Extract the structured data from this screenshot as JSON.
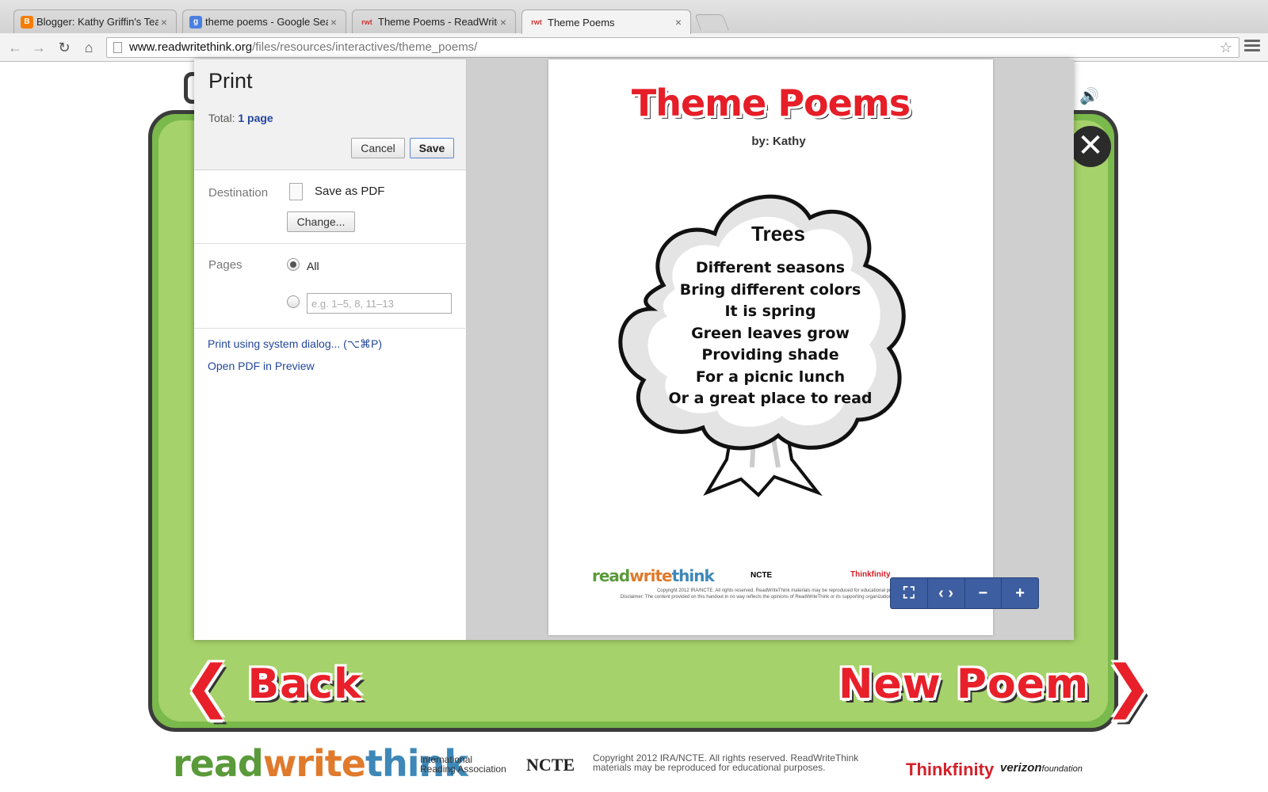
{
  "browser": {
    "tabs": [
      {
        "favicon": "B",
        "title": "Blogger: Kathy Griffin's Tea",
        "active": false
      },
      {
        "favicon": "g",
        "title": "theme poems - Google Sea",
        "active": false
      },
      {
        "favicon": "rwt",
        "title": "Theme Poems - ReadWrite",
        "active": false
      },
      {
        "favicon": "rwt",
        "title": "Theme Poems",
        "active": true
      }
    ],
    "url_host": "www.readwritethink.org",
    "url_path": "/files/resources/interactives/theme_poems/"
  },
  "print_dialog": {
    "title": "Print",
    "total_label": "Total:",
    "total_value": "1 page",
    "cancel_label": "Cancel",
    "save_label": "Save",
    "destination_label": "Destination",
    "destination_value": "Save as PDF",
    "change_label": "Change...",
    "pages_label": "Pages",
    "pages_all_label": "All",
    "pages_range_placeholder": "e.g. 1–5, 8, 11–13",
    "system_dialog_link": "Print using system dialog... (⌥⌘P)",
    "open_pdf_link": "Open PDF in Preview"
  },
  "preview": {
    "title": "Theme Poems",
    "byline": "by: Kathy",
    "poem_title": "Trees",
    "poem_lines": [
      "Different seasons",
      "Bring different colors",
      "It is spring",
      "Green leaves grow",
      "Providing shade",
      "For a picnic lunch",
      "Or a great place to read"
    ],
    "footer_logo": [
      "read",
      "write",
      "think"
    ],
    "footer_ncte": "NCTE",
    "footer_thinkfinity": "Thinkfinity",
    "footer_copyright": "Copyright 2012 IRA/NCTE. All rights reserved. ReadWriteThink materials may be reproduced for educational purposes.",
    "footer_disclaimer": "Disclaimer: The content provided on this handout in no way reflects the opinions of ReadWriteThink or its supporting organizations: IRA, NCTE, or Verizon"
  },
  "zoom_controls": [
    "fit-icon",
    "fit-width-icon",
    "zoom-out-icon",
    "zoom-in-icon"
  ],
  "app": {
    "back_label": "Back",
    "new_poem_label": "New Poem"
  },
  "site_footer": {
    "logo_read": "read",
    "logo_write": "write",
    "logo_think": "think",
    "ira_line1": "International",
    "ira_line2": "Reading Association",
    "ncte": "NCTE",
    "copyright": "Copyright 2012 IRA/NCTE. All rights reserved. ReadWriteThink materials may be reproduced for educational purposes.",
    "thinkfinity": "Thinkfinity",
    "verizon": "verizon",
    "verizon_sub": "foundation"
  }
}
